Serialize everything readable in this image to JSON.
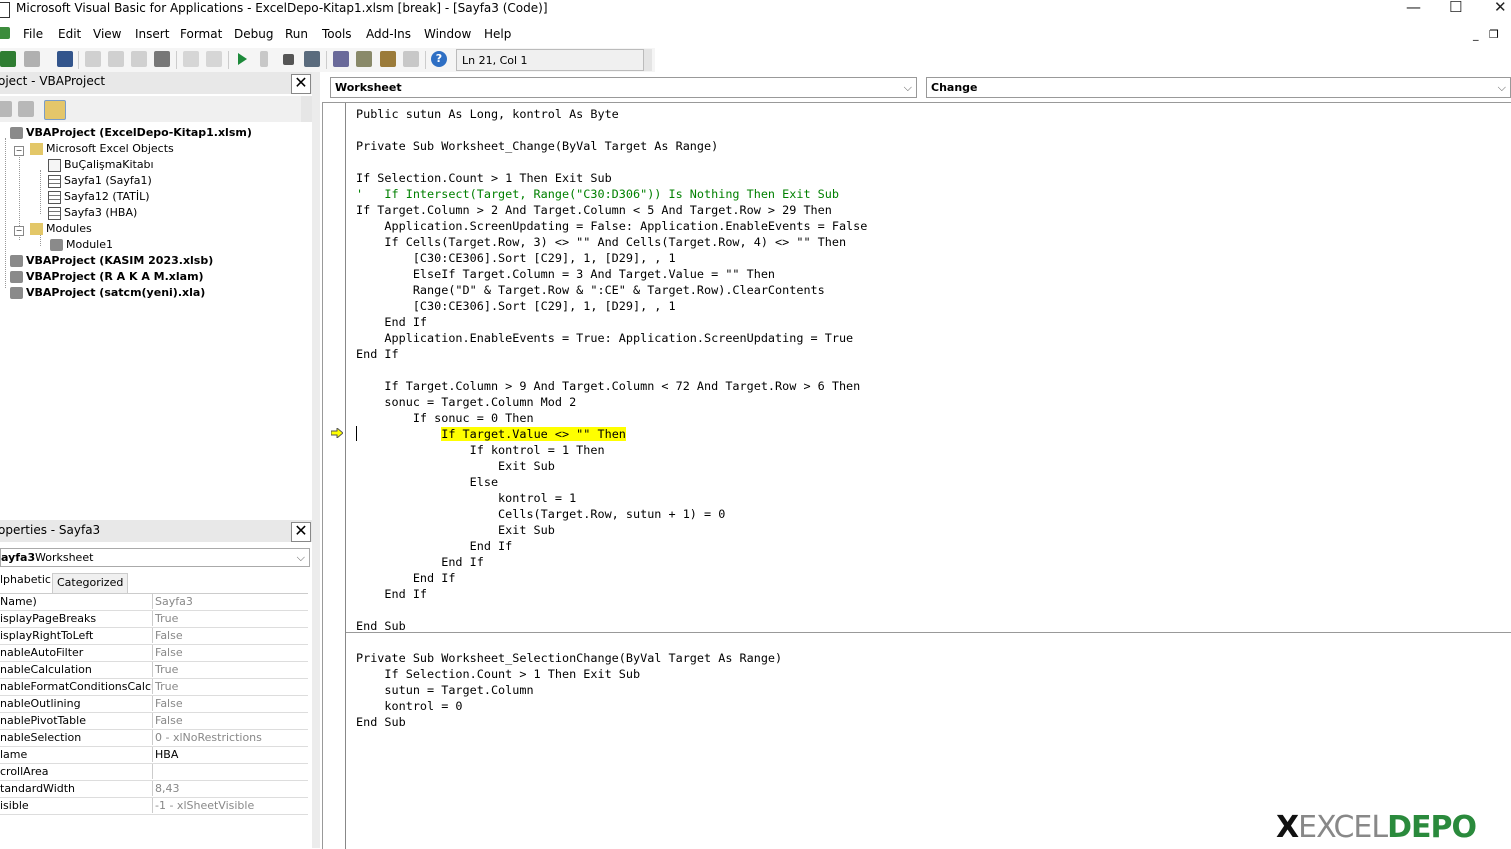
{
  "window": {
    "title": "Microsoft Visual Basic for Applications - ExcelDepo-Kitap1.xlsm [break] - [Sayfa3 (Code)]",
    "minimize": "—",
    "maximize": "☐",
    "close": "✕"
  },
  "menu": {
    "items": [
      "File",
      "Edit",
      "View",
      "Insert",
      "Format",
      "Debug",
      "Run",
      "Tools",
      "Add-Ins",
      "Window",
      "Help"
    ],
    "mdi_minimize": "_",
    "mdi_restore": "❐"
  },
  "toolbar": {
    "position_text": "Ln 21, Col 1"
  },
  "project_panel": {
    "title": "oject - VBAProject",
    "close": "✕",
    "tree": [
      {
        "label": "VBAProject (ExcelDepo-Kitap1.xlsm)",
        "bold": true
      },
      {
        "label": "Microsoft Excel Objects",
        "bold": false
      },
      {
        "label": "BuÇalişmaKitabı",
        "bold": false
      },
      {
        "label": "Sayfa1 (Sayfa1)",
        "bold": false
      },
      {
        "label": "Sayfa12 (TATİL)",
        "bold": false
      },
      {
        "label": "Sayfa3 (HBA)",
        "bold": false
      },
      {
        "label": "Modules",
        "bold": false
      },
      {
        "label": "Module1",
        "bold": false
      },
      {
        "label": "VBAProject (KASIM 2023.xlsb)",
        "bold": true
      },
      {
        "label": "VBAProject (R A K A M.xlam)",
        "bold": true
      },
      {
        "label": "VBAProject (satcm(yeni).xla)",
        "bold": true
      }
    ]
  },
  "properties_panel": {
    "title": "operties - Sayfa3",
    "close": "✕",
    "object_name": "ayfa3",
    "object_type": "Worksheet",
    "tabs": [
      "lphabetic",
      "Categorized"
    ],
    "rows": [
      {
        "key": "Name)",
        "value": "Sayfa3"
      },
      {
        "key": "isplayPageBreaks",
        "value": "True"
      },
      {
        "key": "isplayRightToLeft",
        "value": "False"
      },
      {
        "key": "nableAutoFilter",
        "value": "False"
      },
      {
        "key": "nableCalculation",
        "value": "True"
      },
      {
        "key": "nableFormatConditionsCalculatio",
        "value": "True"
      },
      {
        "key": "nableOutlining",
        "value": "False"
      },
      {
        "key": "nablePivotTable",
        "value": "False"
      },
      {
        "key": "nableSelection",
        "value": "0 - xlNoRestrictions"
      },
      {
        "key": "lame",
        "value": "HBA"
      },
      {
        "key": "crollArea",
        "value": ""
      },
      {
        "key": "tandardWidth",
        "value": "8,43"
      },
      {
        "key": "isible",
        "value": "-1 - xlSheetVisible"
      }
    ]
  },
  "code_window": {
    "object_combo": "Worksheet",
    "procedure_combo": "Change",
    "lines": [
      "Public sutun As Long, kontrol As Byte",
      "",
      "Private Sub Worksheet_Change(ByVal Target As Range)",
      "",
      "If Selection.Count > 1 Then Exit Sub",
      "'   If Intersect(Target, Range(\"C30:D306\")) Is Nothing Then Exit Sub",
      "If Target.Column > 2 And Target.Column < 5 And Target.Row > 29 Then",
      "    Application.ScreenUpdating = False: Application.EnableEvents = False",
      "    If Cells(Target.Row, 3) <> \"\" And Cells(Target.Row, 4) <> \"\" Then",
      "        [C30:CE306].Sort [C29], 1, [D29], , 1",
      "        ElseIf Target.Column = 3 And Target.Value = \"\" Then",
      "        Range(\"D\" & Target.Row & \":CE\" & Target.Row).ClearContents",
      "        [C30:CE306].Sort [C29], 1, [D29], , 1",
      "    End If",
      "    Application.EnableEvents = True: Application.ScreenUpdating = True",
      "End If",
      "",
      "    If Target.Column > 9 And Target.Column < 72 And Target.Row > 6 Then",
      "    sonuc = Target.Column Mod 2",
      "        If sonuc = 0 Then",
      "            If Target.Value <> \"\" Then",
      "                If kontrol = 1 Then",
      "                    Exit Sub",
      "                Else",
      "                    kontrol = 1",
      "                    Cells(Target.Row, sutun + 1) = 0",
      "                    Exit Sub",
      "                End If",
      "            End If",
      "        End If",
      "    End If",
      "",
      "End Sub",
      "",
      "Private Sub Worksheet_SelectionChange(ByVal Target As Range)",
      "    If Selection.Count > 1 Then Exit Sub",
      "    sutun = Target.Column",
      "    kontrol = 0",
      "End Sub"
    ],
    "comment_line_index": 5,
    "highlight_line_index": 20,
    "highlight_color": "#ffff00",
    "comment_color": "#008000"
  },
  "watermark": {
    "text_left": "EXCEL",
    "text_right": "DEPO"
  }
}
